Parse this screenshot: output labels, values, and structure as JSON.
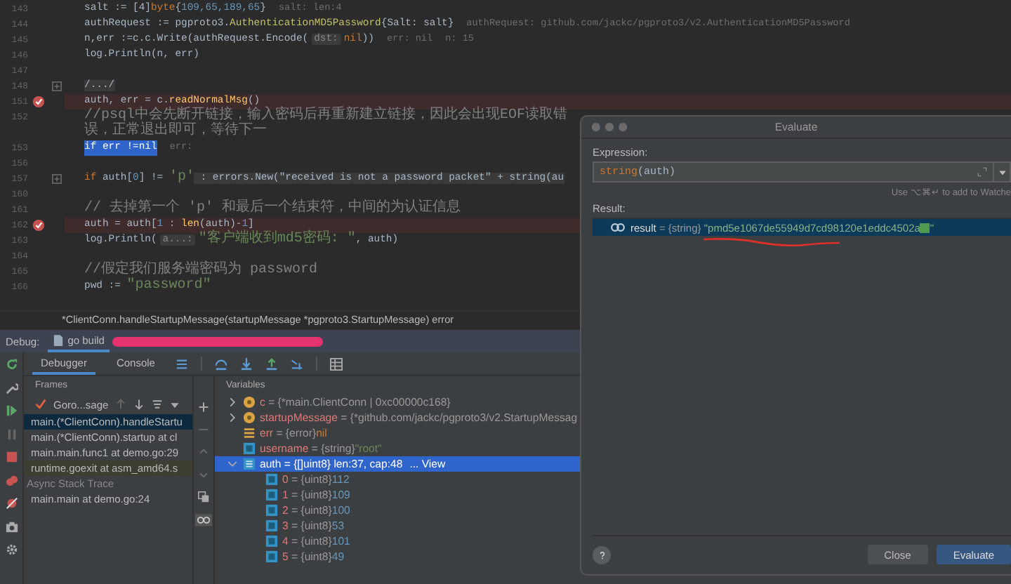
{
  "editor": {
    "lines": [
      {
        "number": "143",
        "kind": "normal",
        "segments": [
          {
            "text": "salt := [4]",
            "kind": "plain"
          },
          {
            "text": "byte",
            "kind": "keyword"
          },
          {
            "text": "{",
            "kind": "plain"
          },
          {
            "text": "109,65,189,65",
            "kind": "number"
          },
          {
            "text": "}",
            "kind": "plain"
          }
        ],
        "hints": [
          "salt: len:4"
        ]
      },
      {
        "number": "144",
        "kind": "normal",
        "segments": [
          {
            "text": "authRequest := pgproto3.",
            "kind": "plain"
          },
          {
            "text": "AuthenticationMD5Password",
            "kind": "type"
          },
          {
            "text": "{Salt: salt}",
            "kind": "plain"
          }
        ],
        "hints": [
          "authRequest: github.com/jackc/pgproto3/v2.AuthenticationMD5Password"
        ]
      },
      {
        "number": "145",
        "kind": "normal",
        "segments": [
          {
            "text": "n,err :=c.c.Write(authRequest.Encode(",
            "kind": "plain"
          },
          {
            "text": "dst:",
            "kind": "param"
          },
          {
            "text": "nil",
            "kind": "keyword"
          },
          {
            "text": "))",
            "kind": "plain"
          }
        ],
        "hints": [
          "err: nil",
          "n: 15"
        ]
      },
      {
        "number": "146",
        "kind": "normal",
        "segments": [
          {
            "text": "log.Println(n, err)",
            "kind": "plain"
          }
        ]
      },
      {
        "number": "147",
        "kind": "normal"
      },
      {
        "number": "148",
        "kind": "normal",
        "segments": [
          {
            "text": "/.../",
            "kind": "fold"
          }
        ]
      },
      {
        "number": "151",
        "kind": "breakpoint",
        "segments": [
          {
            "text": "auth, err = c.",
            "kind": "plain"
          },
          {
            "text": "readNormalMsg",
            "kind": "fn"
          },
          {
            "text": "()",
            "kind": "plain"
          }
        ]
      },
      {
        "number": "152",
        "kind": "normal",
        "segments": [
          {
            "text": "//psql中会先断开链接，输入密码后再重新建立链接，因此会出现EOF读取错误，正常退出即可，等待下一",
            "kind": "comment"
          }
        ]
      },
      {
        "number": "153",
        "kind": "current",
        "segments": [
          {
            "text": "if",
            "kind": "keyword"
          },
          {
            "text": " err !=",
            "kind": "plain"
          },
          {
            "text": "nil",
            "kind": "keyword"
          }
        ],
        "hints": [
          "err:"
        ]
      },
      {
        "number": "156",
        "kind": "normal"
      },
      {
        "number": "157",
        "kind": "normal",
        "segments": [
          {
            "text": "if",
            "kind": "keyword"
          },
          {
            "text": " auth[",
            "kind": "plain"
          },
          {
            "text": "0",
            "kind": "number"
          },
          {
            "text": "] != ",
            "kind": "plain"
          },
          {
            "text": "'p'",
            "kind": "string"
          },
          {
            "text": " : errors.New(\"received is not a password packet\" + string(au",
            "kind": "fold"
          }
        ]
      },
      {
        "number": "160",
        "kind": "normal"
      },
      {
        "number": "161",
        "kind": "normal",
        "segments": [
          {
            "text": "// 去掉第一个 'p' 和最后一个结束符，中间的为认证信息",
            "kind": "comment"
          }
        ]
      },
      {
        "number": "162",
        "kind": "breakpoint",
        "segments": [
          {
            "text": "auth = auth[",
            "kind": "plain"
          },
          {
            "text": "1",
            "kind": "number"
          },
          {
            "text": " : ",
            "kind": "plain"
          },
          {
            "text": "len",
            "kind": "fn"
          },
          {
            "text": "(auth)-",
            "kind": "plain"
          },
          {
            "text": "1",
            "kind": "number"
          },
          {
            "text": "]",
            "kind": "plain"
          }
        ]
      },
      {
        "number": "163",
        "kind": "normal",
        "segments": [
          {
            "text": "log.Println(",
            "kind": "plain"
          },
          {
            "text": "a...:",
            "kind": "param"
          },
          {
            "text": "\"客户端收到md5密码: \"",
            "kind": "string"
          },
          {
            "text": ", auth)",
            "kind": "plain"
          }
        ]
      },
      {
        "number": "164",
        "kind": "normal"
      },
      {
        "number": "165",
        "kind": "normal",
        "segments": [
          {
            "text": "//假定我们服务端密码为 password",
            "kind": "comment"
          }
        ]
      },
      {
        "number": "166",
        "kind": "normal",
        "segments": [
          {
            "text": "pwd := ",
            "kind": "plain"
          },
          {
            "text": "\"password\"",
            "kind": "string"
          }
        ]
      }
    ],
    "breadcrumb": "*ClientConn.handleStartupMessage(startupMessage *pgproto3.StartupMessage) error"
  },
  "debug": {
    "label": "Debug:",
    "run_tab": {
      "label": "go build",
      "selected": true
    },
    "tabs": [
      {
        "label": "Debugger",
        "selected": true
      },
      {
        "label": "Console",
        "selected": false
      }
    ],
    "frames": {
      "title": "Frames",
      "goroutine": "Goro...sage",
      "items": [
        {
          "text": "main.(*ClientConn).handleStartu",
          "kind": "frame",
          "selected": true
        },
        {
          "text": "main.(*ClientConn).startup at cl",
          "kind": "frame",
          "selected": false
        },
        {
          "text": "main.main.func1 at demo.go:29",
          "kind": "frame",
          "selected": false
        },
        {
          "text": "runtime.goexit at asm_amd64.s",
          "kind": "library",
          "selected": false
        },
        {
          "text": "Async Stack Trace",
          "kind": "separator",
          "selected": false
        },
        {
          "text": "main.main at demo.go:24",
          "kind": "frame",
          "selected": false
        }
      ]
    },
    "variables": {
      "title": "Variables",
      "items": [
        {
          "name": "c",
          "type": "= {*main.ClientConn | 0xc00000c168}",
          "kind": "param",
          "expanded": false,
          "selected": false
        },
        {
          "name": "startupMessage",
          "type": "= {*github.com/jackc/pgproto3/v2.StartupMessag",
          "kind": "param",
          "expanded": false,
          "selected": false
        },
        {
          "name": "err",
          "type": "= {error}",
          "value": {
            "text": "nil",
            "kind": "keyword"
          },
          "kind": "interface",
          "selected": false
        },
        {
          "name": "username",
          "type": "= {string}",
          "value": {
            "text": "\"root\"",
            "kind": "string"
          },
          "kind": "local",
          "selected": false
        },
        {
          "name": "auth",
          "type": "= {[]uint8} len:37, cap:48",
          "link": "... View",
          "kind": "array",
          "expanded": true,
          "selected": true,
          "children": [
            {
              "name": "0",
              "type": "= {uint8}",
              "value": {
                "text": "112",
                "kind": "number"
              },
              "kind": "local",
              "selected": false
            },
            {
              "name": "1",
              "type": "= {uint8}",
              "value": {
                "text": "109",
                "kind": "number"
              },
              "kind": "local",
              "selected": false
            },
            {
              "name": "2",
              "type": "= {uint8}",
              "value": {
                "text": "100",
                "kind": "number"
              },
              "kind": "local",
              "selected": false
            },
            {
              "name": "3",
              "type": "= {uint8}",
              "value": {
                "text": "53",
                "kind": "number"
              },
              "kind": "local",
              "selected": false
            },
            {
              "name": "4",
              "type": "= {uint8}",
              "value": {
                "text": "101",
                "kind": "number"
              },
              "kind": "local",
              "selected": false
            },
            {
              "name": "5",
              "type": "= {uint8}",
              "value": {
                "text": "49",
                "kind": "number"
              },
              "kind": "local",
              "selected": false
            }
          ]
        }
      ]
    }
  },
  "evaluate": {
    "title": "Evaluate",
    "expression_label": "Expression:",
    "expression": [
      {
        "text": "string",
        "kind": "keyword"
      },
      {
        "text": "(auth)",
        "kind": "plain"
      }
    ],
    "hint": "Use ⌥⌘↵ to add to Watche",
    "result_label": "Result:",
    "result": {
      "name": "result",
      "type": "= {string}",
      "value": "\"pmd5e1067de55949d7cd98120e1eddc4502a",
      "value_tail": "\"",
      "selected": true
    },
    "buttons": [
      {
        "label": "Close",
        "kind": "secondary"
      },
      {
        "label": "Evaluate",
        "kind": "primary"
      }
    ]
  }
}
